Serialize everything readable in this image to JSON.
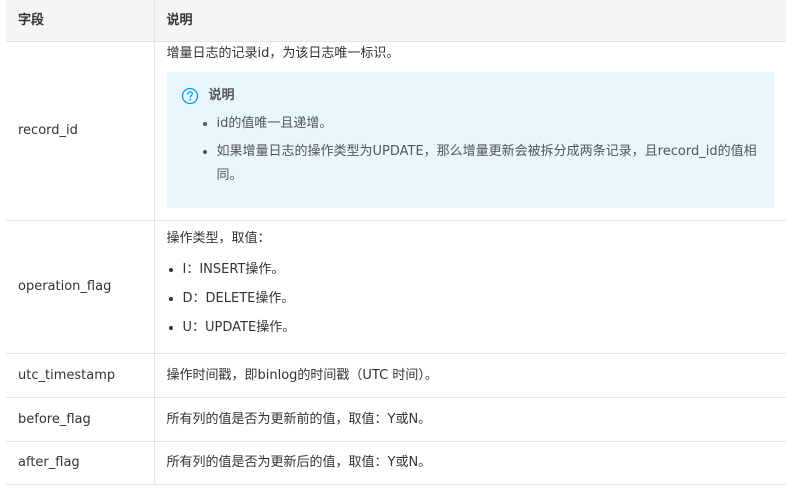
{
  "table": {
    "headers": {
      "field": "字段",
      "description": "说明"
    },
    "rows": {
      "record_id": {
        "field": "record_id",
        "description": "增量日志的记录id，为该日志唯一标识。",
        "note": {
          "title": "说明",
          "icon": "question-circle-icon",
          "items": [
            "id的值唯一且递增。",
            "如果增量日志的操作类型为UPDATE，那么增量更新会被拆分成两条记录，且record_id的值相同。"
          ]
        }
      },
      "operation_flag": {
        "field": "operation_flag",
        "description": "操作类型，取值：",
        "options": [
          "I：INSERT操作。",
          "D：DELETE操作。",
          "U：UPDATE操作。"
        ]
      },
      "utc_timestamp": {
        "field": "utc_timestamp",
        "description": "操作时间戳，即binlog的时间戳（UTC 时间）。"
      },
      "before_flag": {
        "field": "before_flag",
        "description": "所有列的值是否为更新前的值，取值：Y或N。"
      },
      "after_flag": {
        "field": "after_flag",
        "description": "所有列的值是否为更新后的值，取值：Y或N。"
      }
    }
  },
  "colors": {
    "header_bg": "#f5f5f5",
    "note_bg": "#e8f7fd",
    "note_icon": "#00a0e9",
    "border": "#e4e4e4"
  }
}
